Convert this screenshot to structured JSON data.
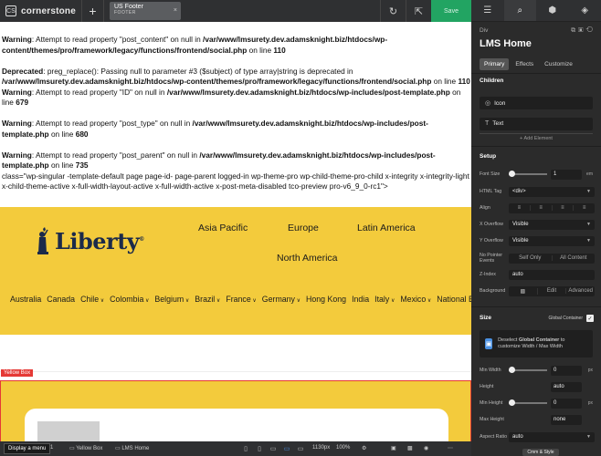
{
  "topbar": {
    "logo_badge": "CS",
    "app_name": "cornerstone",
    "add_symbol": "+",
    "doc_title": "US Footer",
    "doc_subtitle": "FOOTER",
    "doc_close": "×",
    "refresh_icon": "↻",
    "external_icon": "⇱",
    "save_label": "Save"
  },
  "preview": {
    "warnings": [
      {
        "bold": "Warning",
        "text": ": Attempt to read property \"post_content\" on null in ",
        "path": "/var/www/lmsurety.dev.adamsknight.biz/htdocs/wp-content/themes/pro/framework/legacy/functions/frontend/social.php",
        "line_label": " on line ",
        "line": "110"
      },
      {
        "bold": "Deprecated",
        "text": ": preg_replace(): Passing null to parameter #3 ($subject) of type array|string is deprecated in ",
        "path": "/var/www/lmsurety.dev.adamsknight.biz/htdocs/wp-content/themes/pro/framework/legacy/functions/frontend/social.php",
        "line_label": " on line ",
        "line": "110"
      },
      {
        "bold": "Warning",
        "text": ": Attempt to read property \"ID\" on null in ",
        "path": "/var/www/lmsurety.dev.adamsknight.biz/htdocs/wp-includes/post-template.php",
        "line_label": " on line ",
        "line": "679"
      },
      {
        "bold": "Warning",
        "text": ": Attempt to read property \"post_type\" on null in ",
        "path": "/var/www/lmsurety.dev.adamsknight.biz/htdocs/wp-includes/post-template.php",
        "line_label": " on line ",
        "line": "680"
      },
      {
        "bold": "Warning",
        "text": ": Attempt to read property \"post_parent\" on null in ",
        "path": "/var/www/lmsurety.dev.adamsknight.biz/htdocs/wp-includes/post-template.php",
        "line_label": " on line ",
        "line": "735"
      }
    ],
    "class_string": "class=\"wp-singular -template-default page page-id- page-parent logged-in wp-theme-pro wp-child-theme-pro-child x-integrity x-integrity-light x-child-theme-active x-full-width-layout-active x-full-width-active x-post-meta-disabled tco-preview pro-v6_9_0-rc1\">",
    "logo_text": "Liberty",
    "logo_mark": "®",
    "regions": [
      "Asia Pacific",
      "Europe",
      "Latin America",
      "North America"
    ],
    "countries": [
      {
        "label": "Australia",
        "dropdown": false
      },
      {
        "label": "Canada",
        "dropdown": false
      },
      {
        "label": "Chile",
        "dropdown": true
      },
      {
        "label": "Colombia",
        "dropdown": true
      },
      {
        "label": "Belgium",
        "dropdown": true
      },
      {
        "label": "Brazil",
        "dropdown": true
      },
      {
        "label": "France",
        "dropdown": true
      },
      {
        "label": "Germany",
        "dropdown": true
      },
      {
        "label": "Hong Kong",
        "dropdown": false
      },
      {
        "label": "India",
        "dropdown": false
      },
      {
        "label": "Italy",
        "dropdown": true
      },
      {
        "label": "Mexico",
        "dropdown": true
      },
      {
        "label": "National Borg",
        "dropdown": false
      }
    ],
    "yellow_box_tag": "Yellow Box",
    "colors": {
      "brand_yellow": "#f3cb3c",
      "selection_red": "#e53935",
      "save_green": "#22a462"
    }
  },
  "bottombar": {
    "tooltip": "Display a menu",
    "crumb1": "er 1",
    "crumb2": "Yellow Box",
    "crumb3": "LMS Home",
    "width_readout": "1130px",
    "zoom": "100%"
  },
  "inspector": {
    "tabs": [
      "layers-icon",
      "search-icon",
      "element-icon",
      "stack-icon"
    ],
    "element_type": "Div",
    "element_title": "LMS Home",
    "subtabs": [
      "Primary",
      "Effects",
      "Customize"
    ],
    "children_title": "Children",
    "children": [
      {
        "icon": "◎",
        "label": "Icon"
      },
      {
        "icon": "T",
        "label": "Text"
      }
    ],
    "add_element": "+ Add Element",
    "setup_title": "Setup",
    "font_size_label": "Font Size",
    "font_size_value": "1",
    "font_size_unit": "em",
    "html_tag_label": "HTML Tag",
    "html_tag_value": "<div>",
    "align_label": "Align",
    "x_overflow_label": "X Overflow",
    "x_overflow_value": "Visible",
    "y_overflow_label": "Y Overflow",
    "y_overflow_value": "Visible",
    "pointer_label": "No Pointer Events",
    "pointer_options": [
      "Self Only",
      "All Content"
    ],
    "zindex_label": "Z-Index",
    "zindex_value": "auto",
    "background_label": "Background",
    "background_options": [
      "Edit",
      "Advanced"
    ],
    "size_title": "Size",
    "global_container_label": "Global Container",
    "deselect_text_1": "Deselect ",
    "deselect_text_bold": "Global Container",
    "deselect_text_2": " to customize Width / Max Width",
    "min_width_label": "Min Width",
    "min_width_value": "0",
    "min_width_unit": "px",
    "height_label": "Height",
    "height_value": "auto",
    "min_height_label": "Min Height",
    "min_height_value": "0",
    "min_height_unit": "px",
    "max_height_label": "Max Height",
    "max_height_value": "none",
    "aspect_label": "Aspect Ratio",
    "aspect_value": "auto",
    "bottom_button": "Cmm & Style"
  }
}
